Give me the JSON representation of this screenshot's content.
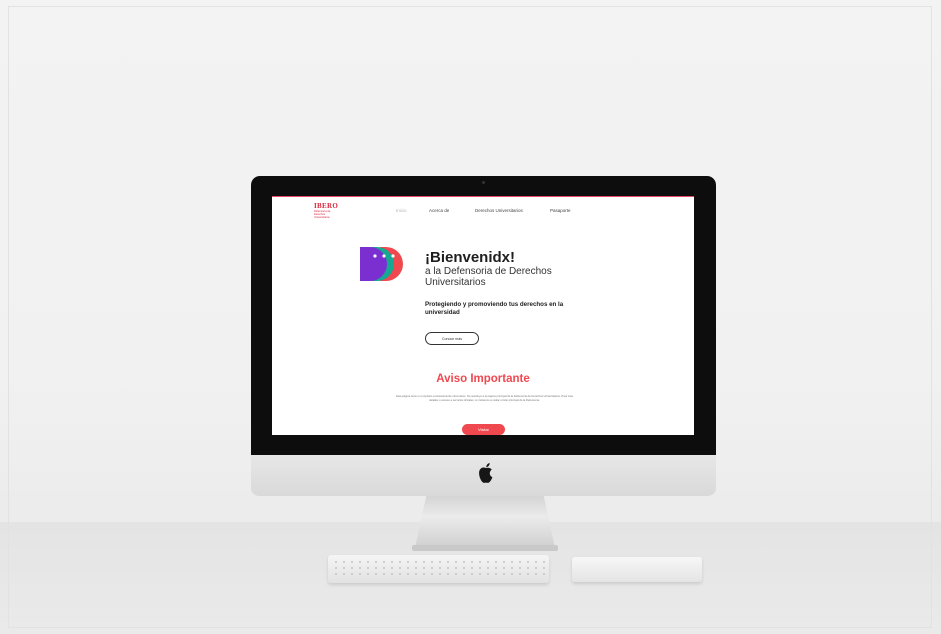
{
  "site": {
    "logo": {
      "word": "IBERO",
      "sub": "Defensoría de Derechos Universitarios"
    },
    "nav": [
      {
        "label": "Inicio",
        "active": true
      },
      {
        "label": "Acerca de",
        "active": false
      },
      {
        "label": "Derechos Universitarios",
        "active": false
      },
      {
        "label": "Pasaporte",
        "active": false
      }
    ],
    "hero": {
      "title": "¡Bienvenidx!",
      "subtitle": "a la Defensoria de Derechos Universitarios",
      "tagline": "Protegiendo y promoviendo tus derechos en la universidad",
      "button_label": "Conoce más"
    },
    "notice": {
      "title": "Aviso Importante",
      "text": "Esta página tiene un propósito exclusivamente informativo. No sustituye a la página principal de la Defensoría de Derechos Universitarios. Para más detalles o acceso a servicios oficiales, te invitamos a visitar el sitio principal de la Defensoría.",
      "button_label": "Visitar"
    },
    "colors": {
      "accent_red": "#f0484f",
      "brand_red": "#d9263d",
      "mark_purple": "#7b2fd0",
      "mark_teal": "#17a893",
      "mark_coral": "#f0484f"
    }
  },
  "device": {
    "icons": [
      "apple-logo-icon"
    ]
  }
}
